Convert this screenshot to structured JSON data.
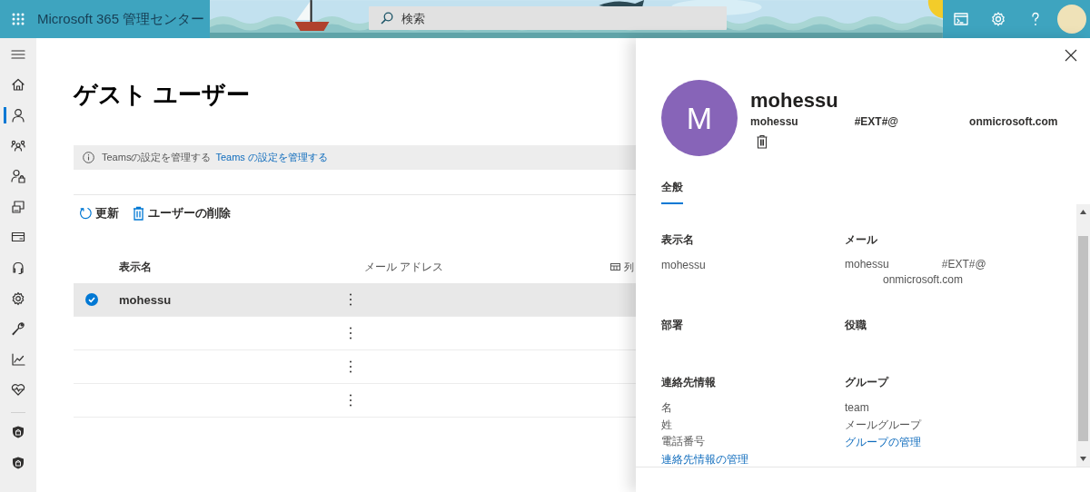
{
  "app_bar": {
    "title": "Microsoft 365 管理センター",
    "search": {
      "placeholder": "検索"
    }
  },
  "nav": {
    "items": [
      {
        "selected": false
      },
      {
        "selected": true
      },
      {
        "selected": false
      },
      {
        "selected": false
      },
      {
        "selected": false
      },
      {
        "selected": false
      },
      {
        "selected": false
      },
      {
        "selected": false
      },
      {
        "selected": false
      },
      {
        "selected": false
      },
      {
        "selected": false
      }
    ],
    "bottom_items": [
      {
        "selected": false
      },
      {
        "selected": false
      }
    ]
  },
  "page": {
    "title": "ゲスト ユーザー",
    "notice": {
      "text": "Teamsの設定を管理する",
      "link": "Teams の設定を管理する"
    },
    "toolbar": [
      {
        "kind": "refresh",
        "label": "更新"
      },
      {
        "kind": "delete",
        "label": "ユーザーの削除"
      }
    ],
    "table": {
      "columns": [
        "表示名",
        "メール アドレス"
      ],
      "column_options": "列",
      "rows": [
        {
          "name": "mohessu",
          "selected": true
        },
        {
          "selected": false
        },
        {
          "selected": false
        },
        {
          "selected": false
        }
      ]
    }
  },
  "panel": {
    "initial": "M",
    "name": "mohessu",
    "email_parts": [
      "mohessu",
      "#EXT#@",
      "onmicrosoft.com"
    ],
    "tabs": [
      {
        "label": "全般",
        "selected": true
      }
    ],
    "fields": [
      {
        "kind": "text",
        "label": "表示名",
        "lines": [
          "mohessu"
        ]
      },
      {
        "kind": "email",
        "label": "メール",
        "lines": [
          "mohessu",
          "#EXT#@",
          "onmicrosoft.com"
        ]
      },
      {
        "kind": "text",
        "label": "部署"
      },
      {
        "kind": "text",
        "label": "役職"
      },
      {
        "kind": "text",
        "label": "連絡先情報",
        "lines": [
          "名",
          "姓",
          "電話番号"
        ],
        "link": "連絡先情報の管理"
      },
      {
        "kind": "text",
        "label": "グループ",
        "lines": [
          "team",
          "メールグループ"
        ],
        "link": "グループの管理"
      }
    ]
  }
}
